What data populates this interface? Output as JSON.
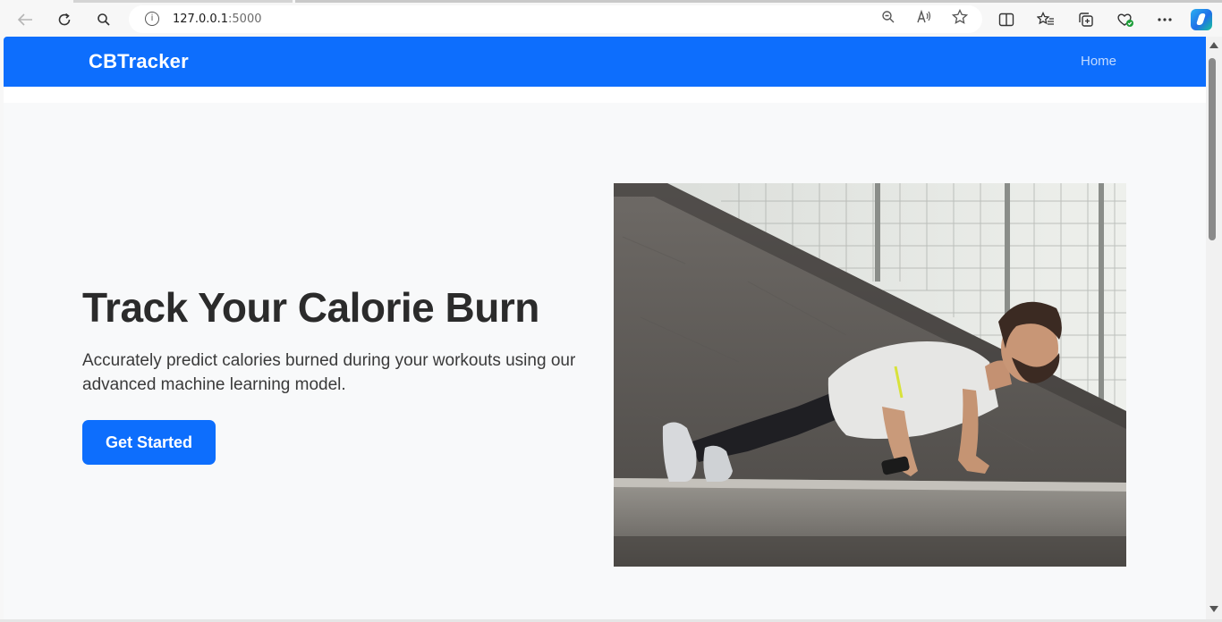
{
  "browser": {
    "url_host": "127.0.0.1",
    "url_port": ":5000"
  },
  "navbar": {
    "brand": "CBTracker",
    "links": [
      "Home"
    ],
    "color": "#0d6efd"
  },
  "hero": {
    "title": "Track Your Calorie Burn",
    "description": "Accurately predict calories burned during your workouts using our advanced machine learning model.",
    "cta_label": "Get Started"
  },
  "icons": {
    "back": "back-arrow-icon",
    "refresh": "refresh-icon",
    "search": "search-icon",
    "info": "info-icon",
    "zoom": "zoom-out-icon",
    "read_aloud": "read-aloud-icon",
    "favorite": "star-icon",
    "split": "split-screen-icon",
    "favorites_bar": "favorites-icon",
    "collections": "collections-icon",
    "extensions": "browser-essentials-icon",
    "more": "more-icon",
    "copilot": "copilot-icon"
  }
}
